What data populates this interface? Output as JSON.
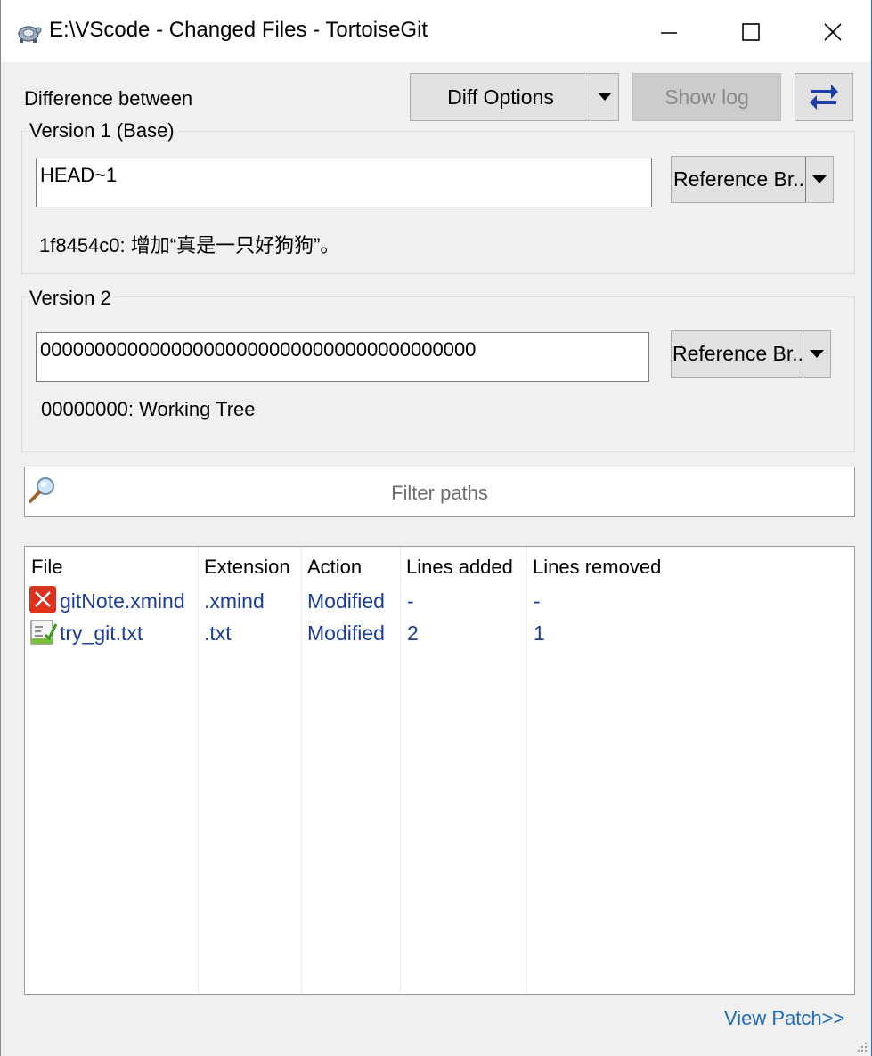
{
  "window": {
    "title": "E:\\VScode - Changed Files - TortoiseGit"
  },
  "header": {
    "difference_label": "Difference between",
    "diff_options_label": "Diff Options",
    "show_log_label": "Show log"
  },
  "version1": {
    "group_title": "Version 1 (Base)",
    "input_value": "HEAD~1",
    "ref_button_label": "Reference Br...",
    "commit_info": "1f8454c0: 增加“真是一只好狗狗”。"
  },
  "version2": {
    "group_title": "Version 2",
    "input_value": "0000000000000000000000000000000000000000",
    "ref_button_label": "Reference Br...",
    "commit_info": "00000000: Working Tree"
  },
  "filter": {
    "placeholder": "Filter paths"
  },
  "files": {
    "columns": [
      "File",
      "Extension",
      "Action",
      "Lines added",
      "Lines removed"
    ],
    "rows": [
      {
        "name": "gitNote.xmind",
        "ext": ".xmind",
        "action": "Modified",
        "added": "-",
        "removed": "-",
        "icon": "xmind-file-icon"
      },
      {
        "name": "try_git.txt",
        "ext": ".txt",
        "action": "Modified",
        "added": "2",
        "removed": "1",
        "icon": "text-file-icon"
      }
    ]
  },
  "footer": {
    "view_patch_label": "View Patch>>"
  },
  "colors": {
    "link": "#1e6bb8",
    "list_text": "#1a3c9c",
    "swap_icon": "#1f3fa8"
  }
}
